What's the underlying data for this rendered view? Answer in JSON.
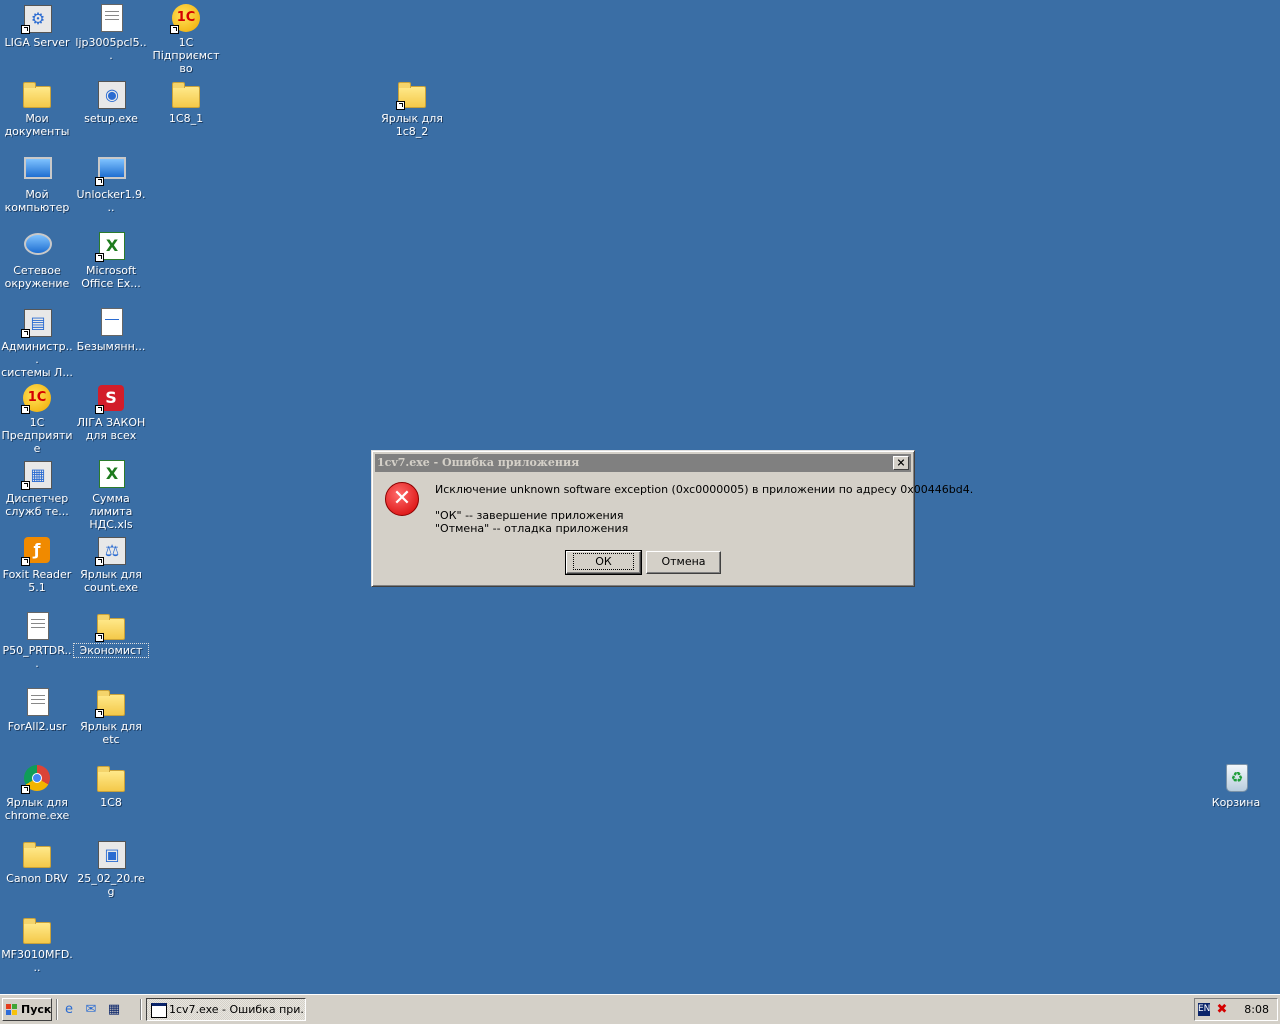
{
  "desktop": {
    "icons": {
      "liga_server": "LIGA Server",
      "ljp3005": "ljp3005pcl5...",
      "onec_pidpr": "1С\nПідприємство",
      "my_docs": "Мои\nдокументы",
      "setup": "setup.exe",
      "onec8_1": "1C8_1",
      "shortcut_1c8_2": "Ярлык для\n1с8_2",
      "my_computer": "Мой\nкомпьютер",
      "unlocker": "Unlocker1.9...",
      "network": "Сетевое\nокружение",
      "excel": "Microsoft\nOffice Ex...",
      "admin": "Администр...\nсистемы Л...",
      "untitled": "Безымянн...",
      "onec_predpr": "1С\nПредприятие",
      "liga_zakon": "ЛІГА ЗАКОН\nдля всех",
      "dispatcher": "Диспетчер\nслужб те...",
      "nds": "Сумма лимита\nНДС.xls",
      "foxit": "Foxit Reader\n5.1",
      "count_exe": "Ярлык для\ncount.exe",
      "p50": "P50_PRTDR...",
      "economist": "Экономист",
      "forall2": "ForAll2.usr",
      "etc": "Ярлык для\netc",
      "chrome": "Ярлык для\nchrome.exe",
      "onec8": "1C8",
      "canon": "Canon DRV",
      "reg": "25_02_20.reg",
      "mf3010": "MF3010MFD...",
      "recycle": "Корзина"
    }
  },
  "dialog": {
    "title": "1cv7.exe - Ошибка приложения",
    "close_glyph": "×",
    "message_line1": "Исключение unknown software exception (0xc0000005) в приложении по адресу 0x00446bd4.",
    "message_line2": "\"ОК\" -- завершение приложения",
    "message_line3": "\"Отмена\" -- отладка приложения",
    "ok_label": "ОК",
    "cancel_label": "Отмена"
  },
  "taskbar": {
    "start_label": "Пуск",
    "task_label": "1cv7.exe - Ошибка при...",
    "lang": "EN",
    "clock": "8:08"
  }
}
